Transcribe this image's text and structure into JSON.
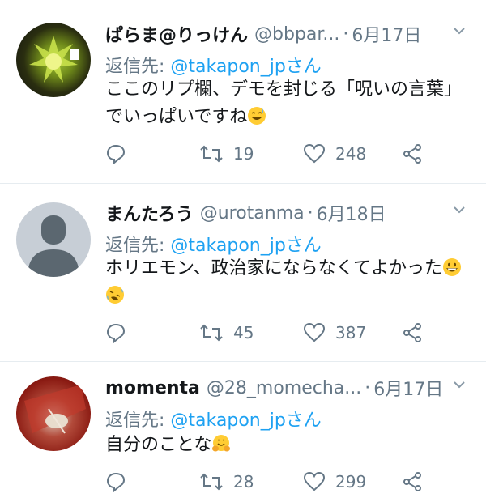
{
  "tweets": [
    {
      "name": "ぱらま@りっけん",
      "handle": "@bbpar...",
      "dot": "·",
      "date": "6月17日",
      "reply_prefix": "返信先:",
      "reply_to": "@takapon_jpさん",
      "text": "ここのリプ欄、デモを封じる「呪いの言葉」でいっぱいですね",
      "emojis": [
        "sweat-smile"
      ],
      "retweets": "19",
      "likes": "248"
    },
    {
      "name": "まんたろう",
      "handle": "@urotanma",
      "dot": "·",
      "date": "6月18日",
      "reply_prefix": "返信先:",
      "reply_to": "@takapon_jpさん",
      "text": "ホリエモン、政治家にならなくてよかった",
      "emojis": [
        "grinning",
        "rofl"
      ],
      "retweets": "45",
      "likes": "387"
    },
    {
      "name": "momenta",
      "handle": "@28_momecha...",
      "dot": "·",
      "date": "6月17日",
      "reply_prefix": "返信先:",
      "reply_to": "@takapon_jpさん",
      "text": "自分のことな",
      "emojis": [
        "hugging"
      ],
      "retweets": "28",
      "likes": "299"
    }
  ],
  "colors": {
    "link": "#1da1f2",
    "muted": "#657786",
    "text": "#14171a",
    "divider": "#e6ecf0"
  }
}
